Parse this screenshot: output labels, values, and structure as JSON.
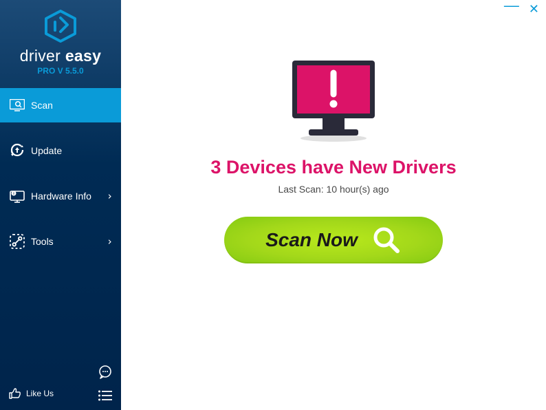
{
  "brand": {
    "word1": "driver",
    "word2": "easy",
    "version_prefix": "PRO V",
    "version": "5.5.0"
  },
  "nav": {
    "scan": "Scan",
    "update": "Update",
    "hardware": "Hardware Info",
    "tools": "Tools"
  },
  "footer": {
    "like": "Like Us"
  },
  "main": {
    "headline": "3 Devices have New Drivers",
    "last_scan": "Last Scan: 10 hour(s) ago",
    "scan_button": "Scan Now"
  },
  "colors": {
    "accent": "#0a9bd8",
    "alert": "#dc1368",
    "scan": "#9bd216"
  }
}
